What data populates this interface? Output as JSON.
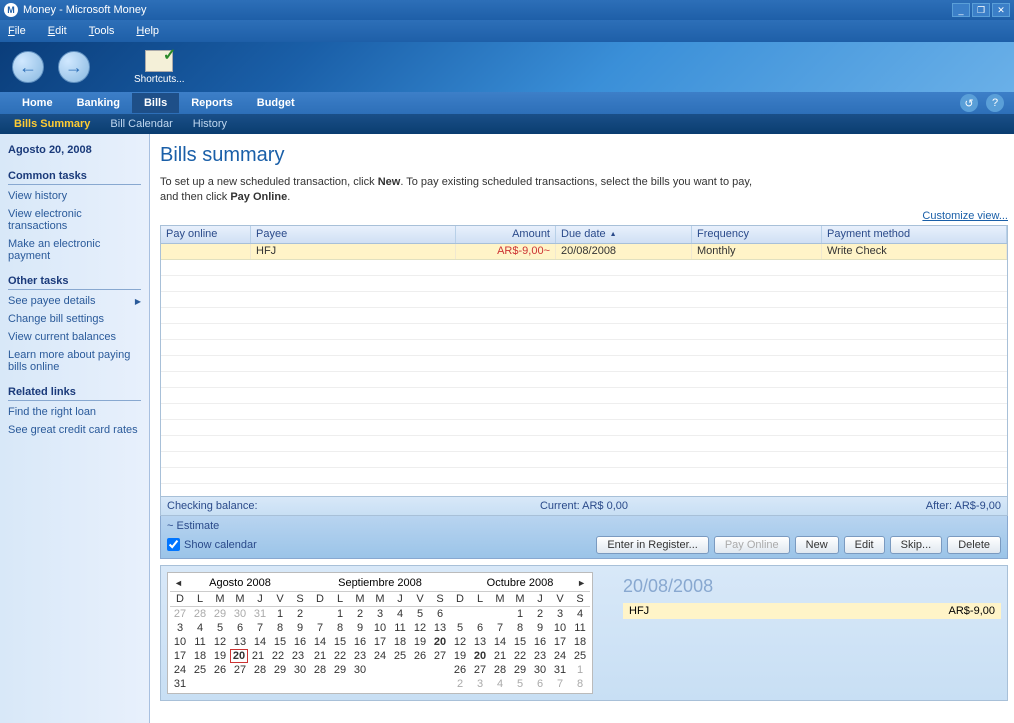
{
  "window": {
    "title": "Money - Microsoft Money",
    "icon_letter": "M"
  },
  "menubar": [
    "File",
    "Edit",
    "Tools",
    "Help"
  ],
  "menubar_keys": [
    "F",
    "E",
    "T",
    "H"
  ],
  "toolbar": {
    "shortcuts": "Shortcuts..."
  },
  "main_nav": [
    "Home",
    "Banking",
    "Bills",
    "Reports",
    "Budget"
  ],
  "main_nav_active": "Bills",
  "sub_nav": [
    "Bills Summary",
    "Bill Calendar",
    "History"
  ],
  "sub_nav_active": "Bills Summary",
  "sidebar": {
    "date": "Agosto 20, 2008",
    "sections": [
      {
        "title": "Common tasks",
        "links": [
          {
            "label": "View history"
          },
          {
            "label": "View electronic transactions"
          },
          {
            "label": "Make an electronic payment"
          }
        ]
      },
      {
        "title": "Other tasks",
        "links": [
          {
            "label": "See payee details",
            "arrow": true
          },
          {
            "label": "Change bill settings"
          },
          {
            "label": "View current balances"
          },
          {
            "label": "Learn more about paying bills online"
          }
        ]
      },
      {
        "title": "Related links",
        "links": [
          {
            "label": "Find the right loan"
          },
          {
            "label": "See great credit card rates"
          }
        ]
      }
    ]
  },
  "page": {
    "title": "Bills summary",
    "intro_1": "To set up a new scheduled transaction, click ",
    "intro_bold1": "New",
    "intro_2": ". To pay existing scheduled transactions, select the bills you want to pay, and then click ",
    "intro_bold2": "Pay Online",
    "intro_3": ".",
    "customize": "Customize view..."
  },
  "table": {
    "columns": [
      "Pay online",
      "Payee",
      "Amount",
      "Due date",
      "Frequency",
      "Payment method"
    ],
    "rows": [
      {
        "payonline": "",
        "payee": "HFJ",
        "amount": "AR$-9,00~",
        "duedate": "20/08/2008",
        "frequency": "Monthly",
        "method": "Write Check"
      }
    ]
  },
  "balance": {
    "label": "Checking balance:",
    "current_label": "Current:",
    "current_val": "AR$ 0,00",
    "after_label": "After:",
    "after_val": "AR$-9,00"
  },
  "estimate": "~ Estimate",
  "show_calendar": "Show calendar",
  "buttons": {
    "enter": "Enter in Register...",
    "payonline": "Pay Online",
    "new": "New",
    "edit": "Edit",
    "skip": "Skip...",
    "delete": "Delete"
  },
  "calendars": {
    "dow": [
      "D",
      "L",
      "M",
      "M",
      "J",
      "V",
      "S"
    ],
    "months": [
      {
        "title": "Agosto 2008",
        "prev": true,
        "weeks": [
          [
            {
              "n": 27,
              "o": true
            },
            {
              "n": 28,
              "o": true
            },
            {
              "n": 29,
              "o": true
            },
            {
              "n": 30,
              "o": true
            },
            {
              "n": 31,
              "o": true
            },
            {
              "n": 1
            },
            {
              "n": 2
            }
          ],
          [
            {
              "n": 3
            },
            {
              "n": 4
            },
            {
              "n": 5
            },
            {
              "n": 6
            },
            {
              "n": 7
            },
            {
              "n": 8
            },
            {
              "n": 9
            }
          ],
          [
            {
              "n": 10
            },
            {
              "n": 11
            },
            {
              "n": 12
            },
            {
              "n": 13
            },
            {
              "n": 14
            },
            {
              "n": 15
            },
            {
              "n": 16
            }
          ],
          [
            {
              "n": 17
            },
            {
              "n": 18
            },
            {
              "n": 19
            },
            {
              "n": 20,
              "today": true,
              "bold": true
            },
            {
              "n": 21
            },
            {
              "n": 22
            },
            {
              "n": 23
            }
          ],
          [
            {
              "n": 24
            },
            {
              "n": 25
            },
            {
              "n": 26
            },
            {
              "n": 27
            },
            {
              "n": 28
            },
            {
              "n": 29
            },
            {
              "n": 30
            }
          ],
          [
            {
              "n": 31
            }
          ]
        ]
      },
      {
        "title": "Septiembre 2008",
        "weeks": [
          [
            {},
            {
              "n": 1
            },
            {
              "n": 2
            },
            {
              "n": 3
            },
            {
              "n": 4
            },
            {
              "n": 5
            },
            {
              "n": 6
            }
          ],
          [
            {
              "n": 7
            },
            {
              "n": 8
            },
            {
              "n": 9
            },
            {
              "n": 10
            },
            {
              "n": 11
            },
            {
              "n": 12
            },
            {
              "n": 13
            }
          ],
          [
            {
              "n": 14
            },
            {
              "n": 15
            },
            {
              "n": 16
            },
            {
              "n": 17
            },
            {
              "n": 18
            },
            {
              "n": 19
            },
            {
              "n": 20,
              "bold": true
            }
          ],
          [
            {
              "n": 21
            },
            {
              "n": 22
            },
            {
              "n": 23
            },
            {
              "n": 24
            },
            {
              "n": 25
            },
            {
              "n": 26
            },
            {
              "n": 27
            }
          ],
          [
            {
              "n": 28
            },
            {
              "n": 29
            },
            {
              "n": 30
            }
          ]
        ]
      },
      {
        "title": "Octubre 2008",
        "next": true,
        "weeks": [
          [
            {},
            {},
            {},
            {
              "n": 1
            },
            {
              "n": 2
            },
            {
              "n": 3
            },
            {
              "n": 4
            }
          ],
          [
            {
              "n": 5
            },
            {
              "n": 6
            },
            {
              "n": 7
            },
            {
              "n": 8
            },
            {
              "n": 9
            },
            {
              "n": 10
            },
            {
              "n": 11
            }
          ],
          [
            {
              "n": 12
            },
            {
              "n": 13
            },
            {
              "n": 14
            },
            {
              "n": 15
            },
            {
              "n": 16
            },
            {
              "n": 17
            },
            {
              "n": 18
            }
          ],
          [
            {
              "n": 19
            },
            {
              "n": 20,
              "bold": true
            },
            {
              "n": 21
            },
            {
              "n": 22
            },
            {
              "n": 23
            },
            {
              "n": 24
            },
            {
              "n": 25
            }
          ],
          [
            {
              "n": 26
            },
            {
              "n": 27
            },
            {
              "n": 28
            },
            {
              "n": 29
            },
            {
              "n": 30
            },
            {
              "n": 31
            },
            {
              "n": 1,
              "o": true
            }
          ],
          [
            {
              "n": 2,
              "o": true
            },
            {
              "n": 3,
              "o": true
            },
            {
              "n": 4,
              "o": true
            },
            {
              "n": 5,
              "o": true
            },
            {
              "n": 6,
              "o": true
            },
            {
              "n": 7,
              "o": true
            },
            {
              "n": 8,
              "o": true
            }
          ]
        ]
      }
    ]
  },
  "detail": {
    "date": "20/08/2008",
    "payee": "HFJ",
    "amount": "AR$-9,00"
  }
}
